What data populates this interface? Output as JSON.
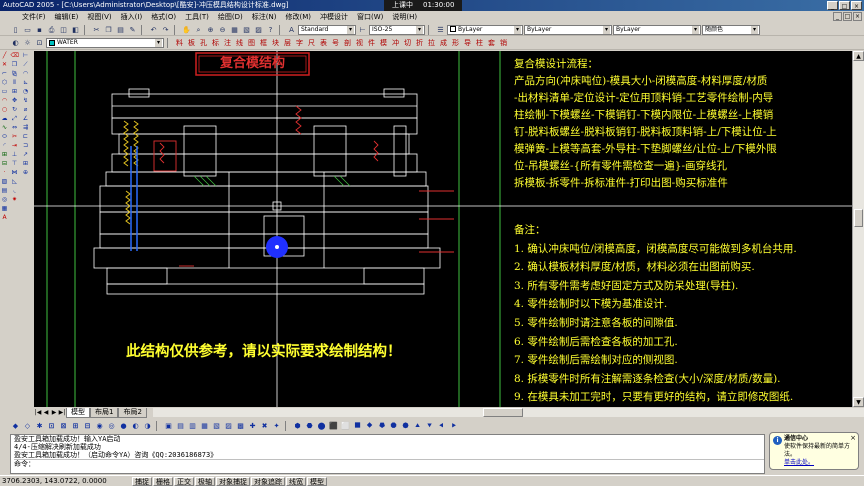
{
  "window": {
    "title": "AutoCAD 2005 - [C:\\Users\\Administrator\\Desktop\\[酷安]-冲压模具结构设计标准.dwg]",
    "controls": [
      "_",
      "□",
      "×"
    ]
  },
  "recorder": {
    "status": "上课中",
    "time": "01:30:00"
  },
  "menu": {
    "items": [
      "文件(F)",
      "编辑(E)",
      "视图(V)",
      "插入(I)",
      "格式(O)",
      "工具(T)",
      "绘图(D)",
      "标注(N)",
      "修改(M)",
      "冲模设计",
      "窗口(W)",
      "说明(H)"
    ]
  },
  "toolbar": {
    "text_style": "Standard",
    "dim_style": "ISO-25",
    "color": "ByLayer",
    "linetype": "ByLayer",
    "lineweight": "ByLayer",
    "plot_style": "随颜色",
    "layer": "WATER"
  },
  "drawing": {
    "title": "复合模结构",
    "process_title": "复合模设计流程：",
    "process_lines": [
      "产品方向(冲床吨位)-模具大小-闭模高度-材料厚度/材质",
      "-出材料清单-定位设计-定位用顶料销-工艺零件绘制-内导",
      "柱绘制-下模螺丝-下模销钉-下模内限位-上模螺丝-上模销",
      "钉-脱料板螺丝-脱料板销钉-脱料板顶料销-上/下模让位-上",
      "模弹簧-上模等高套-外导柱-下垫脚螺丝/让位-上/下模外限",
      "位-吊模螺丝-{所有零件需检查一遍}-画穿线孔",
      "拆模板-拆零件-拆标准件-打印出图-购买标准件"
    ],
    "notes_title": "备注：",
    "notes": [
      "1. 确认冲床吨位/闭模高度，闭模高度尽可能做到多机台共用.",
      "2. 确认模板材料厚度/材质，材料必须在出图前购买.",
      "3. 所有零件需考虑好固定方式及防呆处理(导柱).",
      "4. 零件绘制时以下模为基准设计.",
      "5. 零件绘制时请注意各板的间隙值.",
      "6. 零件绘制后需检查各板的加工孔.",
      "7. 零件绘制后需绘制对应的侧视图.",
      "8. 拆模零件时所有注解需逐条检查(大小/深度/材质/数量).",
      "9. 在模具未加工完时，只要有更好的结构，请立即修改图纸."
    ],
    "disclaimer": "此结构仅供参考，请以实际要求绘制结构！"
  },
  "tabs": {
    "nav": [
      "|◀",
      "◀",
      "▶",
      "▶|"
    ],
    "items": [
      "模型",
      "布局1",
      "布局2"
    ]
  },
  "command": {
    "lines": [
      "盈安工具箱加载成功！输入YA启动",
      "4/4-压缩解决刷新加载成功",
      "盈安工具箱加载成功！（启动命令YA）咨询《QQ:2036186873》"
    ],
    "prompt": "命令："
  },
  "notification": {
    "title": "通信中心",
    "body": "使软件保持最新的简单方法。",
    "link": "单击此处。"
  },
  "status": {
    "coords": "3706.2303, 143.0722, 0.0000",
    "toggles": [
      "捕捉",
      "栅格",
      "正交",
      "极轴",
      "对象捕捉",
      "对象追踪",
      "线宽",
      "模型"
    ]
  }
}
